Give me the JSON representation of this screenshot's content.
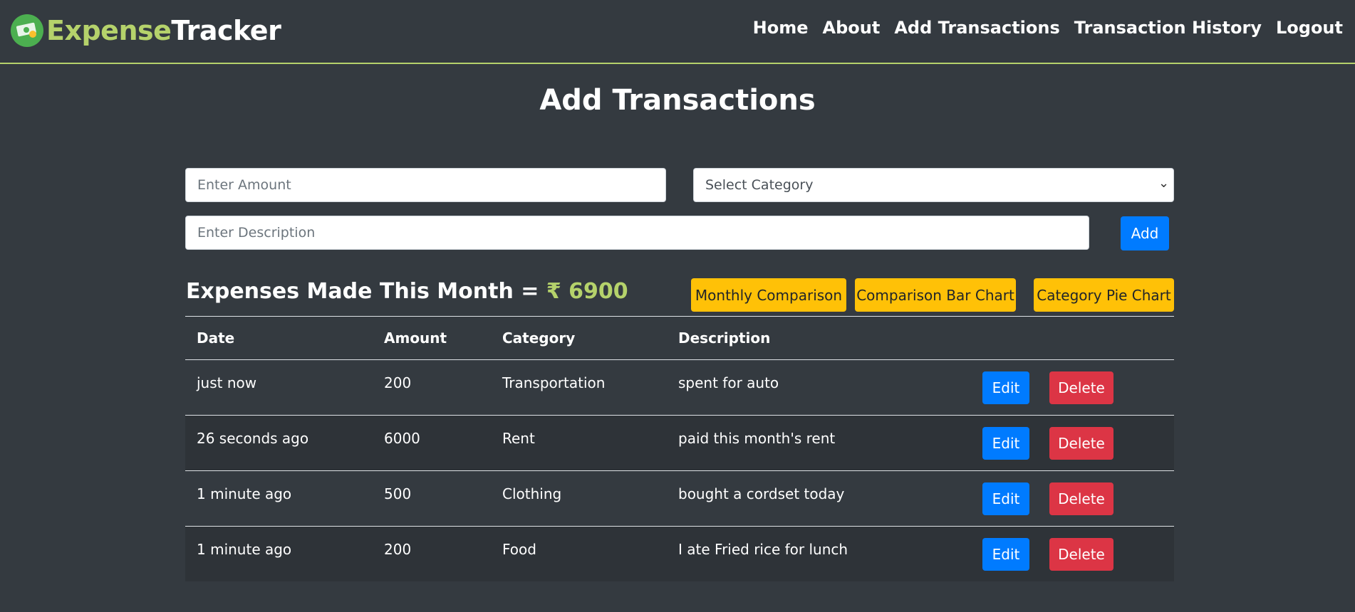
{
  "brand": {
    "part1": "Expense",
    "part2": "Tracker"
  },
  "nav": [
    "Home",
    "About",
    "Add Transactions",
    "Transaction History",
    "Logout"
  ],
  "page_title": "Add Transactions",
  "form": {
    "amount_placeholder": "Enter Amount",
    "category_selected": "Select Category",
    "description_placeholder": "Enter Description",
    "add_label": "Add"
  },
  "summary": {
    "label": "Expenses Made This Month =",
    "value": "₹ 6900"
  },
  "chart_buttons": [
    "Monthly Comparison",
    "Comparison Bar Chart",
    "Category Pie Chart"
  ],
  "table": {
    "headers": [
      "Date",
      "Amount",
      "Category",
      "Description"
    ],
    "rows": [
      {
        "date": "just now",
        "amount": "200",
        "category": "Transportation",
        "description": "spent for auto"
      },
      {
        "date": "26 seconds ago",
        "amount": "6000",
        "category": "Rent",
        "description": "paid this month's rent"
      },
      {
        "date": "1 minute ago",
        "amount": "500",
        "category": "Clothing",
        "description": "bought a cordset today"
      },
      {
        "date": "1 minute ago",
        "amount": "200",
        "category": "Food",
        "description": "I ate Fried rice for lunch"
      }
    ],
    "edit_label": "Edit",
    "delete_label": "Delete"
  },
  "colors": {
    "background": "#343a40",
    "accent": "#b5d26b",
    "primary": "#007bff",
    "danger": "#dc3545",
    "warning": "#ffc107"
  }
}
